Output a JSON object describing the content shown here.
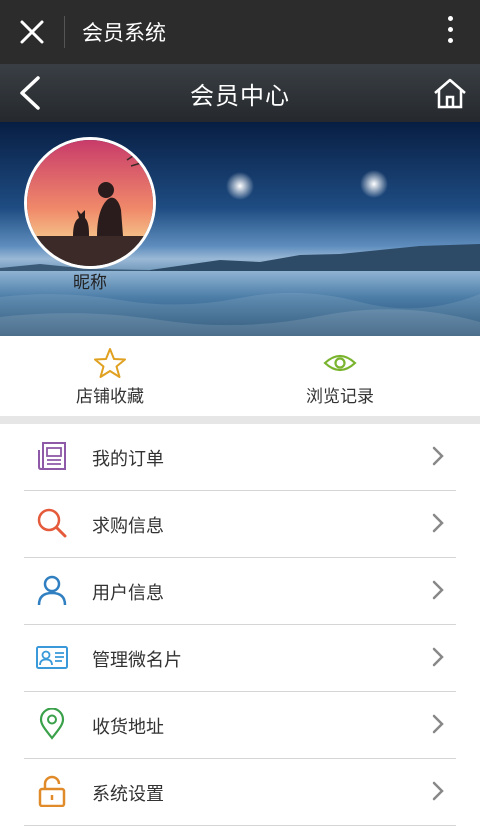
{
  "wechat_bar": {
    "title": "会员系统"
  },
  "header": {
    "title": "会员中心"
  },
  "profile": {
    "nickname": "昵称"
  },
  "quick_actions": [
    {
      "label": "店铺收藏",
      "icon": "star-icon"
    },
    {
      "label": "浏览记录",
      "icon": "eye-icon"
    }
  ],
  "menu": [
    {
      "label": "我的订单",
      "icon": "order-icon"
    },
    {
      "label": "求购信息",
      "icon": "search-icon"
    },
    {
      "label": "用户信息",
      "icon": "user-icon"
    },
    {
      "label": "管理微名片",
      "icon": "card-icon"
    },
    {
      "label": "收货地址",
      "icon": "location-icon"
    },
    {
      "label": "系统设置",
      "icon": "lock-icon"
    }
  ],
  "colors": {
    "star": "#e0a020",
    "eye": "#7ab42e",
    "order": "#8e5aa8",
    "search": "#e45a3a",
    "user": "#2f7fc1",
    "card": "#3a9ad9",
    "location": "#3aa14a",
    "lock": "#e08a2a"
  }
}
